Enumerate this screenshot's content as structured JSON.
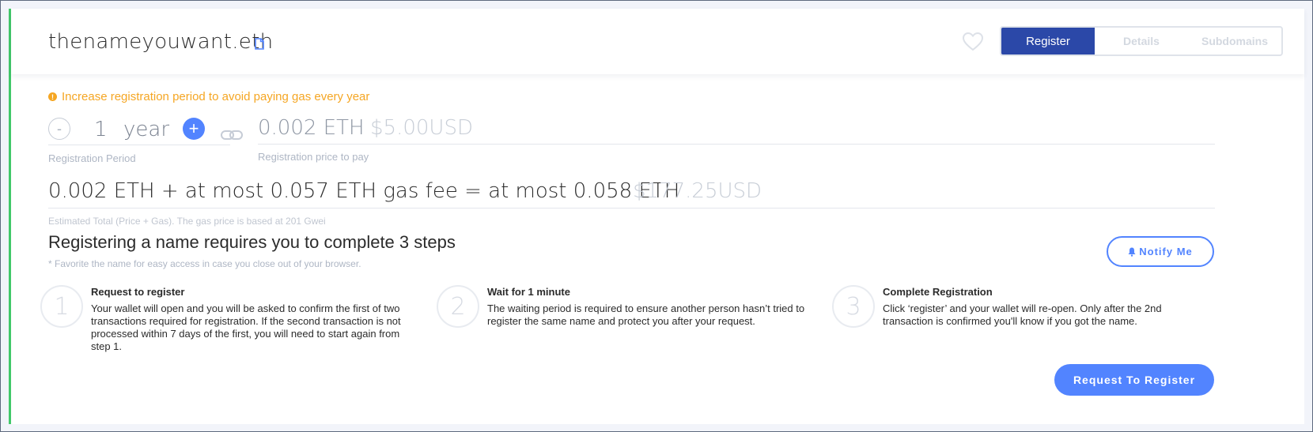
{
  "header": {
    "name": "thenameyouwant.eth",
    "tabs": [
      {
        "label": "Register",
        "active": true
      },
      {
        "label": "Details",
        "active": false
      },
      {
        "label": "Subdomains",
        "active": false
      }
    ]
  },
  "warning": {
    "text": "Increase registration period to avoid paying gas every year"
  },
  "period": {
    "minus_label": "-",
    "value": "1",
    "unit": "year",
    "plus_label": "+",
    "label": "Registration Period"
  },
  "price": {
    "eth": "0.002 ETH",
    "usd": "$5.00USD",
    "label": "Registration price to pay"
  },
  "total": {
    "text": "0.002 ETH + at most 0.057 ETH gas fee = at most 0.058 ETH",
    "usd": "$177.25USD",
    "label": "Estimated Total (Price + Gas). The gas price is based at 201 Gwei"
  },
  "steps_section": {
    "title": "Registering a name requires you to complete 3 steps",
    "note": "* Favorite the name for easy access in case you close out of your browser.",
    "notify_label": "Notify Me",
    "steps": [
      {
        "number": "1",
        "title": "Request to register",
        "description": "Your wallet will open and you will be asked to confirm the first of two transactions required for registration. If the second transaction is not processed within 7 days of the first, you will need to start again from step 1."
      },
      {
        "number": "2",
        "title": "Wait for 1 minute",
        "description": "The waiting period is required to ensure another person hasn’t tried to register the same name and protect you after your request."
      },
      {
        "number": "3",
        "title": "Complete Registration",
        "description": "Click ‘register’ and your wallet will re-open. Only after the 2nd transaction is confirmed you'll know if you got the name."
      }
    ]
  },
  "actions": {
    "request_label": "Request To Register"
  },
  "colors": {
    "accent": "#5284ff",
    "tab_active": "#2b48a8",
    "warning": "#f5a623",
    "status_bar": "#42c86a"
  }
}
